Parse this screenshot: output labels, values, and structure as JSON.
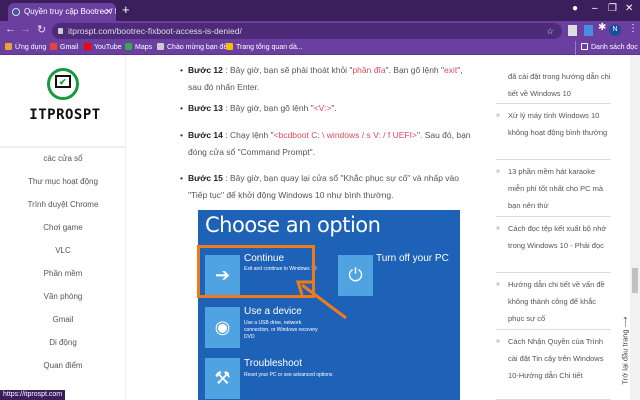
{
  "browser": {
    "tab_title": "Quyền truy cập Bootrec / fixboot",
    "new_tab": "+",
    "url": "itprospt.com/bootrec-fixboot-access-is-denied/",
    "bookmarks": [
      {
        "label": "Ứng dụng",
        "color": "#e7a33b"
      },
      {
        "label": "Gmail",
        "color": "#ea4335"
      },
      {
        "label": "YouTube",
        "color": "#ff0000"
      },
      {
        "label": "Maps",
        "color": "#34a853"
      },
      {
        "label": "Chào mừng bạn đế...",
        "color": "#cccccc"
      },
      {
        "label": "Trang tổng quan dà...",
        "color": "#fbbc05"
      }
    ],
    "reading_list": "Danh sách đọc",
    "profile_initial": "N",
    "status_url": "https://itprospt.com"
  },
  "logo": {
    "text": "ITPROSPT"
  },
  "left_nav": [
    "các cửa sổ",
    "Thư mục hoạt động",
    "Trình duyệt Chrome",
    "Chơi game",
    "VLC",
    "Phần mềm",
    "Văn phòng",
    "Gmail",
    "Di động",
    "Quan điểm"
  ],
  "steps": [
    {
      "label": "Bước 12",
      "parts": [
        " : Bây giờ, bạn sẽ phải thoát khỏi \"",
        "phần đĩa",
        "\". Bạn gõ lệnh \"",
        "exit",
        "\", sau đó nhấn Enter."
      ]
    },
    {
      "label": "Bước 13",
      "parts": [
        " : Bây giờ, bạn gõ lệnh \"",
        "<V:>",
        "\"."
      ]
    },
    {
      "label": "Bước 14",
      "parts": [
        " : Chạy lệnh \"",
        "<bcdboot C: \\ windows / s V: / f UEFI>",
        "\". Sau đó, bạn đóng cửa sổ \"Command Prompt\"."
      ]
    },
    {
      "label": "Bước 15",
      "parts": [
        " : Bây giờ, bạn quay lại cửa sổ \"Khắc phục sự cố\" và nhấp vào \"Tiếp tục\" để khởi động Windows 10 như bình thường."
      ]
    }
  ],
  "image": {
    "heading": "Choose an option",
    "continue": {
      "title": "Continue",
      "sub": "Exit and continue to Windows 10"
    },
    "turnoff": {
      "title": "Turn off your PC"
    },
    "device": {
      "title": "Use a device",
      "sub": "Use a USB drive, network connection, or Windows recovery DVD"
    },
    "troubleshoot": {
      "title": "Troubleshoot",
      "sub": "Reset your PC or see advanced options"
    },
    "highlight_color": "#f07a1a"
  },
  "related": [
    "đã cài đặt trong hướng dẫn chi tiết về Windows 10",
    "Xử lý máy tính Windows 10 không hoạt động bình thường",
    "13 phần mềm hát karaoke miễn phí tốt nhất cho PC mà bạn nên thử",
    "Cách đọc tệp kết xuất bộ nhớ trong Windows 10 - Phải đọc",
    "Hướng dẫn chi tiết về vấn đề không thành công để khắc phục sự cố",
    "Cách Nhận Quyền của Trình cài đặt Tin cậy trên Windows 10-Hướng dẫn Chi tiết"
  ],
  "back_to_top": "Trở lại đầu trang"
}
